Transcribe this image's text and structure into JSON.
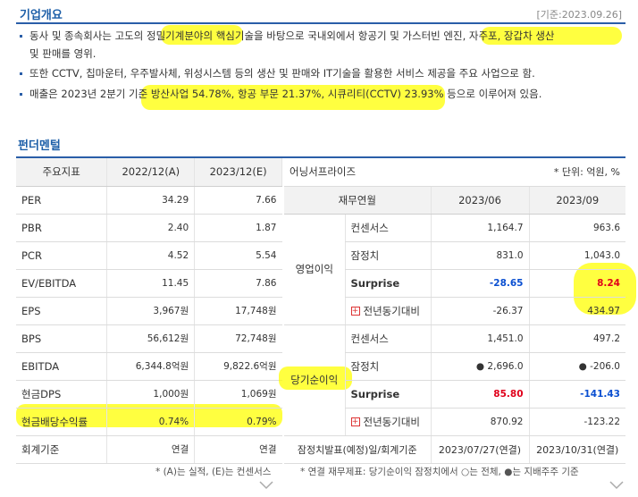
{
  "overview": {
    "title": "기업개요",
    "date": "[기준:2023.09.26]",
    "bullets": [
      "동사 및 종속회사는 고도의 정밀기계분야의 핵심기술을 바탕으로 국내외에서 항공기 및 가스터빈 엔진, 자주포, 장갑차 생산",
      "및 판매를 영위.",
      "또한 CCTV, 칩마운터, 우주발사체, 위성시스템 등의 생산 및 판매와 IT기술을 활용한 서비스 제공을 주요 사업으로 함.",
      "매출은 2023년 2분기 기준 방산사업 54.78%, 항공 부문 21.37%, 시큐리티(CCTV) 23.93% 등으로 이루어져 있음."
    ]
  },
  "fundamental": {
    "title": "펀더멘털",
    "left": {
      "headers": [
        "주요지표",
        "2022/12(A)",
        "2023/12(E)"
      ],
      "rows": [
        [
          "PER",
          "34.29",
          "7.66"
        ],
        [
          "PBR",
          "2.40",
          "1.87"
        ],
        [
          "PCR",
          "4.52",
          "5.54"
        ],
        [
          "EV/EBITDA",
          "11.45",
          "7.86"
        ],
        [
          "EPS",
          "3,967원",
          "17,748원"
        ],
        [
          "BPS",
          "56,612원",
          "72,748원"
        ],
        [
          "EBITDA",
          "6,344.8억원",
          "9,822.6억원"
        ],
        [
          "현금DPS",
          "1,000원",
          "1,069원"
        ],
        [
          "현금배당수익률",
          "0.74%",
          "0.79%"
        ],
        [
          "회계기준",
          "연결",
          "연결"
        ]
      ],
      "note": "* (A)는 실적, (E)는 컨센서스"
    },
    "right": {
      "title": "어닝서프라이즈",
      "unit": "* 단위: 억원, %",
      "headers": [
        "재무연월",
        "2023/06",
        "2023/09"
      ],
      "group1": "영업이익",
      "group2": "당기순이익",
      "op": [
        [
          "컨센서스",
          "1,164.7",
          "963.6"
        ],
        [
          "잠정치",
          "831.0",
          "1,043.0"
        ],
        [
          "Surprise",
          "-28.65",
          "8.24"
        ],
        [
          "전년동기대비",
          "-26.37",
          "434.97"
        ]
      ],
      "net": [
        [
          "컨센서스",
          "1,451.0",
          "497.2"
        ],
        [
          "잠정치",
          "2,696.0",
          "-206.0"
        ],
        [
          "Surprise",
          "85.80",
          "-141.43"
        ],
        [
          "전년동기대비",
          "870.92",
          "-123.22"
        ]
      ],
      "footer": [
        "잠정치발표(예정)일/회계기준",
        "2023/07/27(연결)",
        "2023/10/31(연결)"
      ],
      "note": "* 연결 재무제표: 당기순이익 잠정치에서 ○는 전체, ●는 지배주주 기준"
    }
  }
}
